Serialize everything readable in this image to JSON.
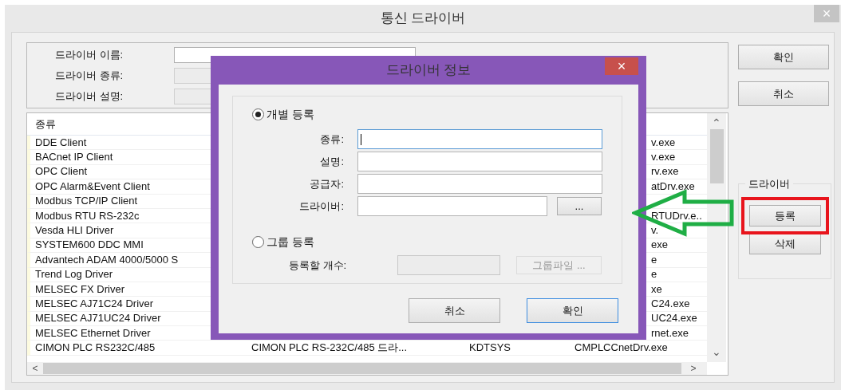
{
  "window": {
    "title": "통신 드라이버",
    "close": "×"
  },
  "info_fields": [
    {
      "label": "드라이버 이름:",
      "disabled": false
    },
    {
      "label": "드라이버 종류:",
      "disabled": true
    },
    {
      "label": "드라이버 설명:",
      "disabled": true
    }
  ],
  "buttons": [
    {
      "label": "확인"
    },
    {
      "label": "취소"
    }
  ],
  "driver_list": {
    "columns": [
      "종류"
    ],
    "rows": [
      {
        "name": "DDE Client",
        "column_4": "v.exe"
      },
      {
        "name": "BACnet IP Client",
        "column_4": "v.exe"
      },
      {
        "name": "OPC Client",
        "column_4": "rv.exe"
      },
      {
        "name": "OPC Alarm&Event Client",
        "column_4": "atDrv.exe"
      },
      {
        "name": "Modbus TCP/IP Client"
      },
      {
        "name": "Modbus RTU RS-232c",
        "column_4": "RTUDrv.e.."
      },
      {
        "name": "Vesda HLI Driver",
        "column_4": "v."
      },
      {
        "name": "SYSTEM600 DDC MMI",
        "column_4": "exe"
      },
      {
        "name": "Advantech ADAM 4000/5000 S",
        "column_4": "e"
      },
      {
        "name": "Trend Log Driver",
        "column_4": "e"
      },
      {
        "name": "MELSEC FX Driver",
        "column_4": "xe"
      },
      {
        "name": "MELSEC AJ71C24 Driver",
        "column_4": "C24.exe"
      },
      {
        "name": "MELSEC AJ71UC24 Driver",
        "column_4": "UC24.exe"
      },
      {
        "name": "MELSEC Ethernet Driver",
        "column_4": "rnet.exe"
      },
      {
        "name": "CIMON PLC RS232C/485",
        "column_2": "CIMON PLC RS-232C/485 드라...",
        "column_3": "KDTSYS",
        "column_4": "CMPLCCnetDrv.exe"
      }
    ],
    "scroll_up": "⌃",
    "scroll_down": "⌄",
    "scroll_left": "<",
    "scroll_right": ">"
  },
  "driver_group": {
    "title": "드라이버",
    "buttons": [
      {
        "label": "등록",
        "highlighted": true
      },
      {
        "label": "삭제",
        "highlighted": false
      }
    ]
  },
  "dialog": {
    "title": "드라이버 정보",
    "close": "×",
    "options": [
      {
        "label": "개별 등록",
        "selected": true,
        "fields": [
          {
            "label": "종류:",
            "focused": true
          },
          {
            "label": "설명:",
            "focused": false
          },
          {
            "label": "공급자:",
            "focused": false
          },
          {
            "label": "드라이버:",
            "focused": false,
            "browse": "..."
          }
        ]
      },
      {
        "label": "그룹 등록",
        "selected": false,
        "fields": [
          {
            "label": "등록할 개수:",
            "disabled": true,
            "browse": "그룹파일 ..."
          }
        ]
      }
    ],
    "buttons": [
      {
        "label": "취소",
        "focused": false
      },
      {
        "label": "확인",
        "focused": true
      }
    ]
  }
}
